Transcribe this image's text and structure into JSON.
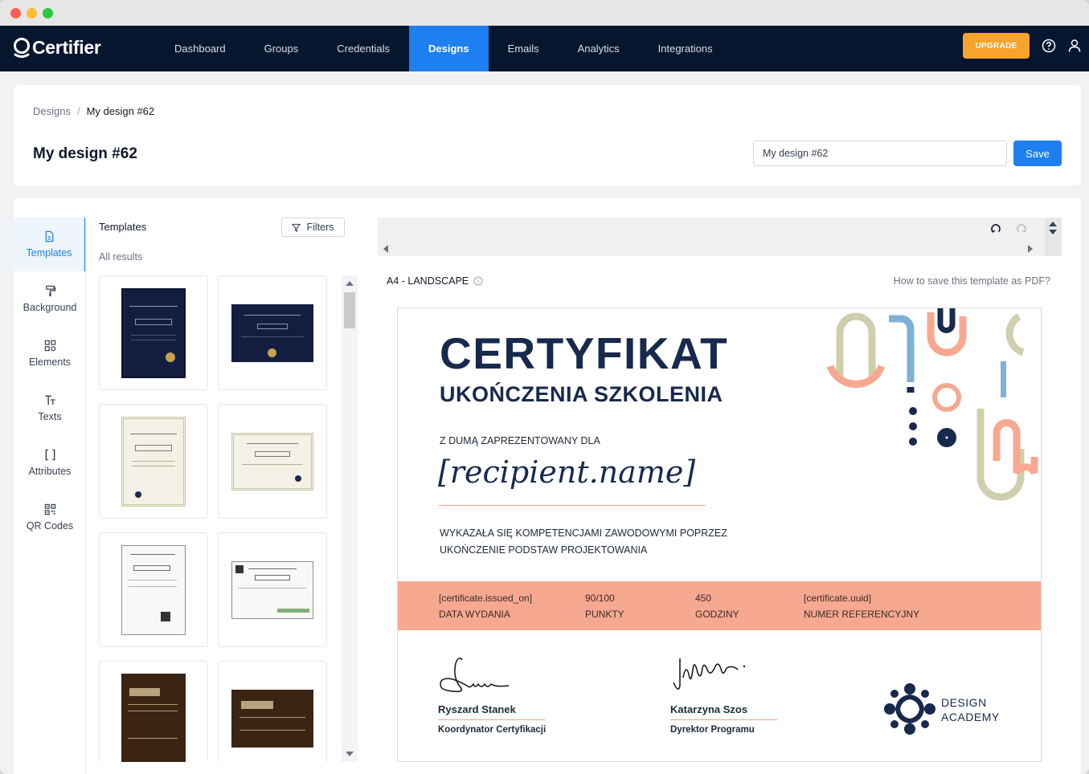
{
  "app": {
    "brand": "Certifier"
  },
  "nav": {
    "items": [
      "Dashboard",
      "Groups",
      "Credentials",
      "Designs",
      "Emails",
      "Analytics",
      "Integrations"
    ],
    "active": "Designs",
    "upgrade_label": "UPGRADE"
  },
  "breadcrumb": {
    "root": "Designs",
    "separator": "/",
    "current": "My design #62"
  },
  "header": {
    "title": "My design #62",
    "name_input_value": "My design #62",
    "save_label": "Save"
  },
  "sidebar": {
    "items": [
      {
        "label": "Templates",
        "icon": "file-icon",
        "active": true
      },
      {
        "label": "Background",
        "icon": "paint-roller-icon",
        "active": false
      },
      {
        "label": "Elements",
        "icon": "elements-icon",
        "active": false
      },
      {
        "label": "Texts",
        "icon": "text-icon",
        "active": false
      },
      {
        "label": "Attributes",
        "icon": "brackets-icon",
        "active": false
      },
      {
        "label": "QR Codes",
        "icon": "qr-code-icon",
        "active": false
      }
    ]
  },
  "templates": {
    "title": "Templates",
    "filters_label": "Filters",
    "results_label": "All results"
  },
  "preview": {
    "paper_size": "A4 - LANDSCAPE",
    "help_link": "How to save this template as PDF?"
  },
  "certificate": {
    "title": "CERTYFIKAT",
    "subtitle": "UKOŃCZENIA SZKOLENIA",
    "proudly": "Z DUMĄ ZAPREZENTOWANY DLA",
    "recipient": "[recipient.name]",
    "description_line1": "WYKAZAŁA SIĘ KOMPETENCJAMI ZAWODOWYMI POPRZEZ",
    "description_line2": "UKOŃCZENIE PODSTAW PROJEKTOWANIA",
    "band": [
      {
        "value": "[certificate.issued_on]",
        "label": "DATA WYDANIA"
      },
      {
        "value": "90/100",
        "label": "PUNKTY"
      },
      {
        "value": "450",
        "label": "GODZINY"
      },
      {
        "value": "[certificate.uuid]",
        "label": "NUMER REFERENCYJNY"
      }
    ],
    "signatures": [
      {
        "name": "Ryszard Stanek",
        "role": "Koordynator Certyfikacji"
      },
      {
        "name": "Katarzyna Szos",
        "role": "Dyrektor Programu"
      }
    ],
    "academy_line1": "DESIGN",
    "academy_line2": "ACADEMY",
    "colors": {
      "navy": "#17294d",
      "salmon": "#f7a891",
      "sage": "#cfcfae",
      "blue": "#7fb1d6"
    }
  },
  "colors": {
    "navbar": "#07162f",
    "accent": "#1e7ff0",
    "upgrade": "#f7a32c"
  }
}
